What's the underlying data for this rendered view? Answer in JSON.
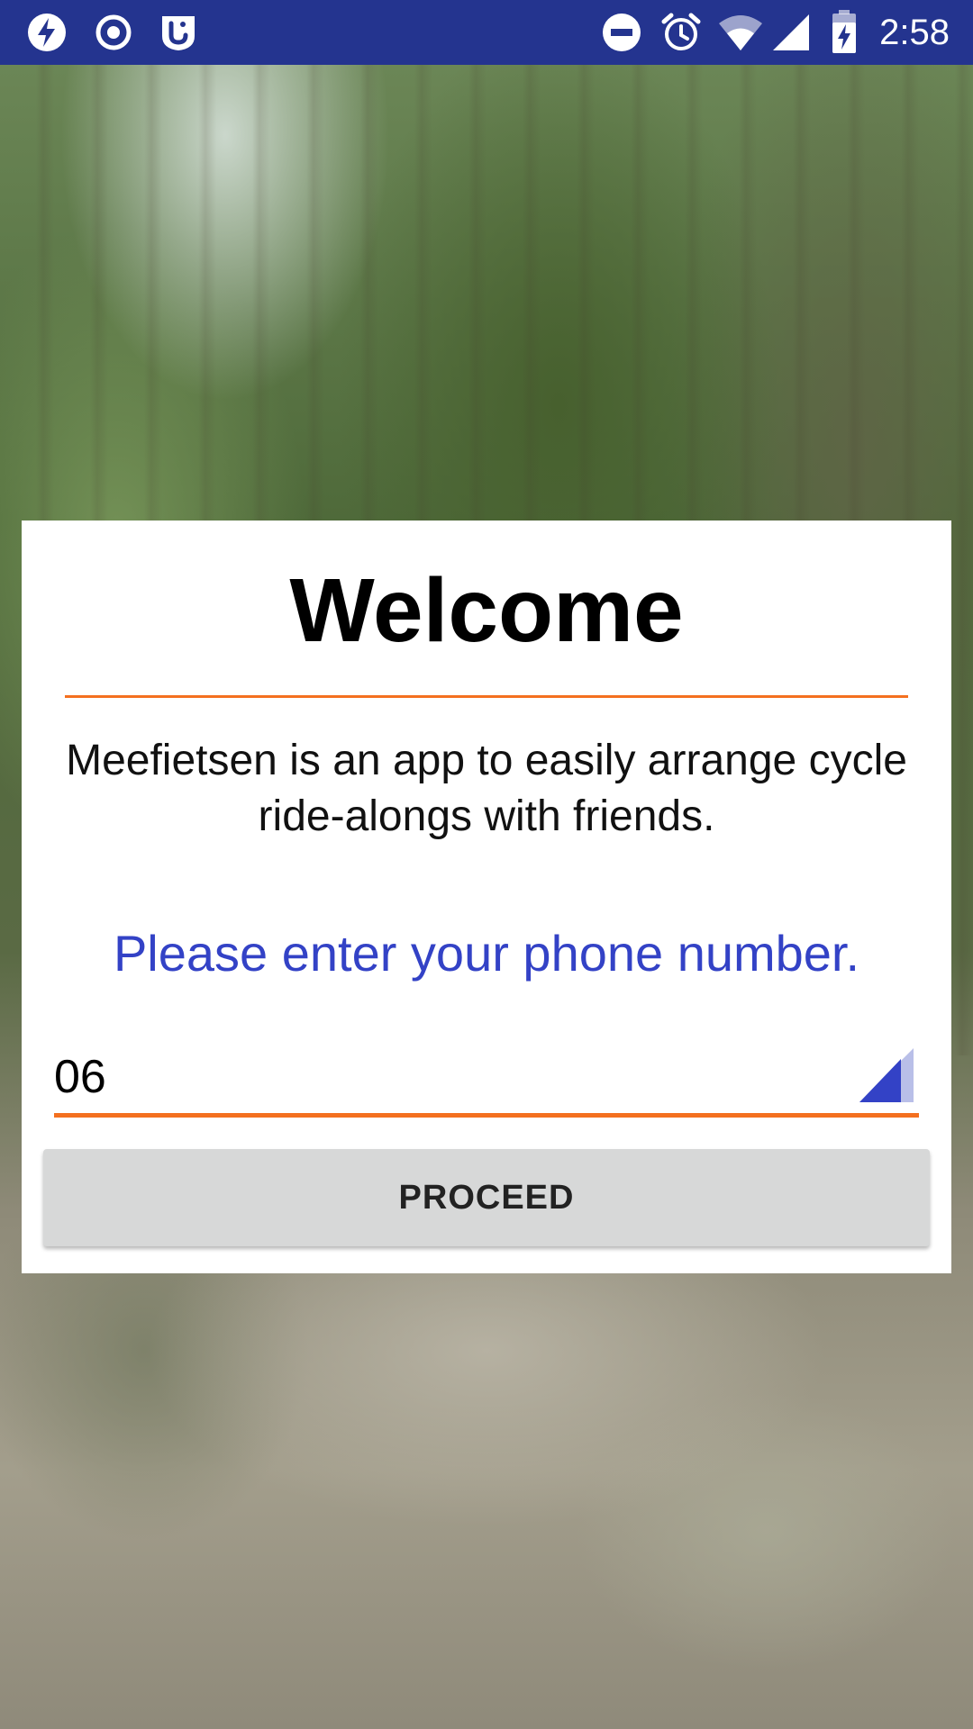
{
  "status_bar": {
    "time": "2:58",
    "left_icons": [
      "flash-icon",
      "record-icon",
      "shield-app-icon"
    ],
    "right_icons": [
      "do-not-disturb-icon",
      "alarm-icon",
      "wifi-icon",
      "signal-icon",
      "battery-charging-icon"
    ],
    "background_color": "#24348f"
  },
  "welcome_card": {
    "title": "Welcome",
    "description": "Meefietsen is an app to easily arrange cycle ride-alongs with friends.",
    "prompt": "Please enter your phone number.",
    "phone_field": {
      "value": "06",
      "placeholder": ""
    },
    "proceed_label": "PROCEED"
  },
  "colors": {
    "accent_orange": "#f4701f",
    "prompt_blue": "#3342c6",
    "button_gray": "#d7d8d8"
  }
}
